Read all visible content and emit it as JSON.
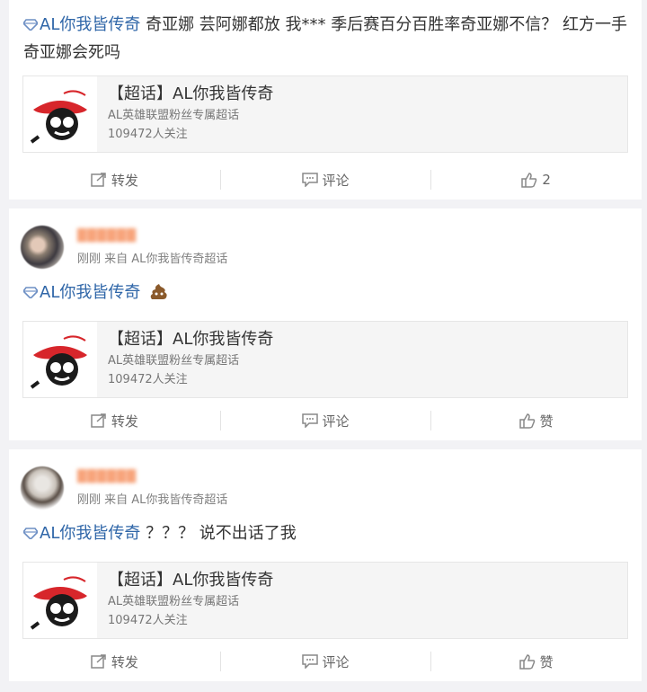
{
  "posts": [
    {
      "topic": "AL你我皆传奇",
      "text": " 奇亚娜 芸阿娜都放 我*** 季后赛百分百胜率奇亚娜不信？ 红方一手奇亚娜会死吗",
      "card": {
        "title": "【超话】AL你我皆传奇",
        "desc": "AL英雄联盟粉丝专属超话",
        "followers": "109472人关注"
      },
      "actions": {
        "repost": "转发",
        "comment": "评论",
        "like": "2"
      }
    },
    {
      "username": "██████",
      "meta": "刚刚 来自 AL你我皆传奇超话",
      "topic": "AL你我皆传奇",
      "text": " ",
      "emoji_icon": "poop-icon",
      "card": {
        "title": "【超话】AL你我皆传奇",
        "desc": "AL英雄联盟粉丝专属超话",
        "followers": "109472人关注"
      },
      "actions": {
        "repost": "转发",
        "comment": "评论",
        "like": "赞"
      }
    },
    {
      "username": "██████",
      "meta": "刚刚 来自 AL你我皆传奇超话",
      "topic": "AL你我皆传奇",
      "text": " ？？？ 说不出话了我",
      "card": {
        "title": "【超话】AL你我皆传奇",
        "desc": "AL英雄联盟粉丝专属超话",
        "followers": "109472人关注"
      },
      "actions": {
        "repost": "转发",
        "comment": "评论",
        "like": "赞"
      }
    }
  ],
  "icons": {
    "topic": "diamond-icon",
    "repost": "repost-icon",
    "comment": "comment-icon",
    "like": "thumbs-up-icon"
  },
  "colors": {
    "link": "#2f66a8",
    "background": "#f2f2f5",
    "card": "#f5f5f5",
    "logo_red": "#d7262b"
  }
}
